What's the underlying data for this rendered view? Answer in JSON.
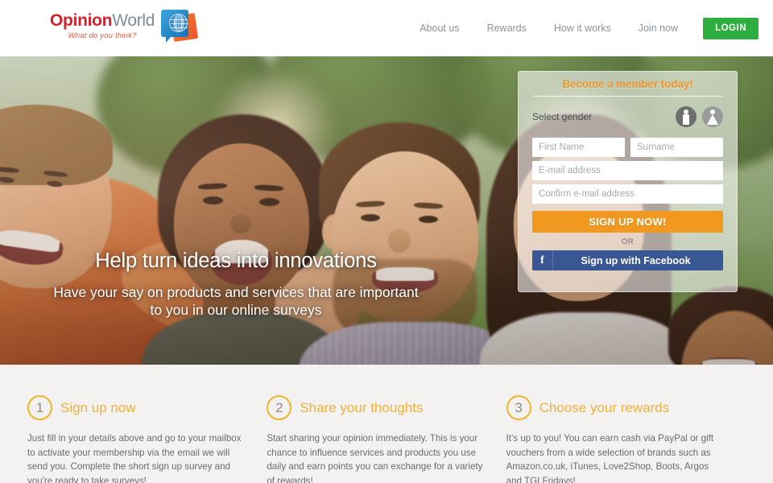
{
  "header": {
    "logo": {
      "primary": "Opinion",
      "secondary": "World",
      "tagline": "What do you think?",
      "mark": "globe-speech-bubble-logo"
    },
    "nav": [
      {
        "label": "About us",
        "name": "nav-about-us"
      },
      {
        "label": "Rewards",
        "name": "nav-rewards"
      },
      {
        "label": "How it works",
        "name": "nav-how-it-works"
      },
      {
        "label": "Join now",
        "name": "nav-join-now"
      }
    ],
    "login_label": "LOGIN",
    "login_color": "#2dae3f"
  },
  "hero": {
    "title": "Help turn ideas into innovations",
    "subtitle": "Have your say on products and services that are important to you in our online surveys"
  },
  "signup": {
    "title": "Become a member today!",
    "gender_label": "Select gender",
    "gender_male": "male-gender-icon",
    "gender_female": "female-gender-icon",
    "first_name_placeholder": "First Name",
    "first_name_value": "",
    "surname_placeholder": "Surname",
    "surname_value": "",
    "email_placeholder": "E-mail address",
    "email_value": "",
    "confirm_email_placeholder": "Confirm e-mail address",
    "confirm_email_value": "",
    "cta_label": "SIGN UP NOW!",
    "cta_color": "#f0981f",
    "or_label": "OR",
    "facebook_label": "Sign up with Facebook",
    "facebook_icon": "f",
    "facebook_color": "#3a5795"
  },
  "steps": [
    {
      "number": "1",
      "title": "Sign up now",
      "text": "Just fill in your details above and go to your mailbox to activate your membership via the email we will send you. Complete the short sign up survey and you're ready to take surveys!"
    },
    {
      "number": "2",
      "title": "Share your thoughts",
      "text": "Start sharing your opinion immediately. This is your chance to influence services and products you use daily and earn points you can exchange for a variety of rewards!"
    },
    {
      "number": "3",
      "title": "Choose your rewards",
      "text": "It's up to you! You can earn cash via PayPal or gift vouchers from a wide selection of brands such as Amazon.co.uk, iTunes, Love2Shop, Boots, Argos and TGI Fridays!"
    }
  ]
}
